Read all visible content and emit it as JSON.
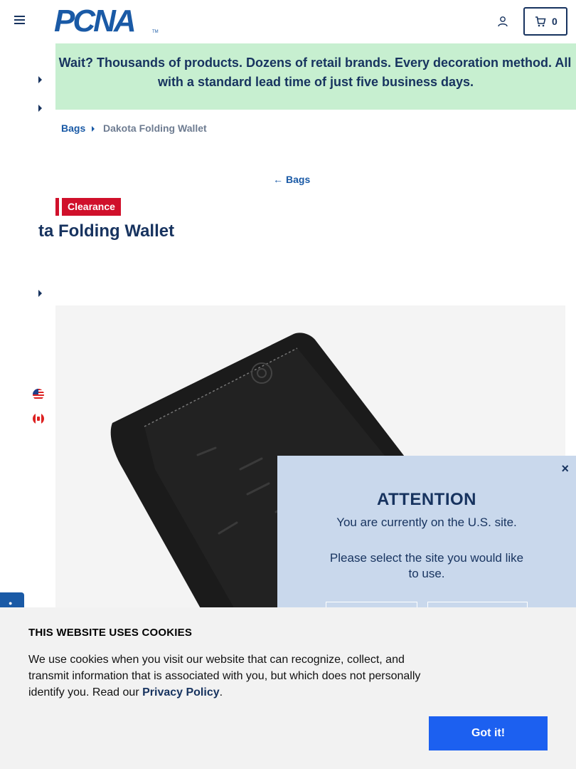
{
  "header": {
    "logo_text": "PCNA",
    "logo_tm": "TM",
    "cart_count": "0"
  },
  "promo": {
    "line1": "Wait? Thousands of products. Dozens of retail brands. Every decoration method. All",
    "line2": "with a standard lead time of just five business days."
  },
  "breadcrumb": {
    "category": "Bags",
    "current": "Dakota Folding Wallet"
  },
  "back_link": {
    "arrow": "←",
    "label": "Bags"
  },
  "product": {
    "badge": "Clearance",
    "title": "ta Folding Wallet"
  },
  "attention": {
    "close": "×",
    "title": "ATTENTION",
    "message": "You are currently on the U.S. site.",
    "prompt": "Please select the site you would like to use."
  },
  "cookie": {
    "title": "THIS WEBSITE USES COOKIES",
    "text": "We use cookies when you visit our website that can recognize, collect, and transmit information that is associated with you, but which does not personally identify you. Read our ",
    "link": "Privacy Policy",
    "after": ".",
    "button": "Got it!"
  },
  "colors": {
    "navy": "#17335f",
    "brand_blue": "#1a5aa6",
    "promo_green": "#c7efd0",
    "clearance_red": "#d0102b",
    "attention_bg": "#c9d8ec",
    "got_it_blue": "#1c60f0"
  },
  "icons": [
    "menu-icon",
    "user-icon",
    "cart-icon",
    "caret-right-icon",
    "us-flag-icon",
    "canada-flag-icon",
    "close-icon",
    "arrow-left-icon"
  ]
}
